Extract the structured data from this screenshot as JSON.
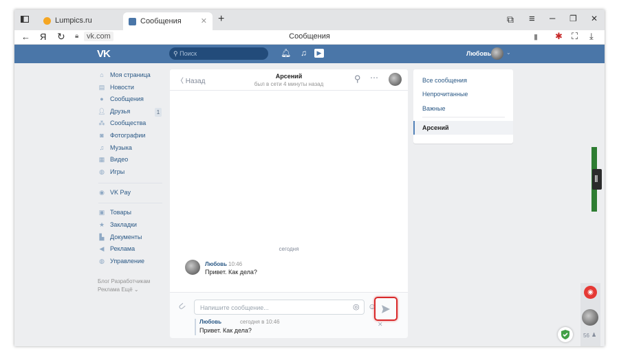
{
  "browser": {
    "tabs": [
      {
        "title": "Lumpics.ru",
        "favicon_color": "#f5a623"
      },
      {
        "title": "Сообщения",
        "favicon_color": "#4a76a8"
      }
    ],
    "new_tab": "+",
    "yandex_logo": "Я",
    "url": "vk.com",
    "page_title": "Сообщения"
  },
  "vk": {
    "header": {
      "logo": "VK",
      "search_placeholder": "Поиск",
      "user_name": "Любовь"
    },
    "left_menu": [
      {
        "label": "Моя страница",
        "icon": "home-icon"
      },
      {
        "label": "Новости",
        "icon": "news-icon"
      },
      {
        "label": "Сообщения",
        "icon": "messages-icon"
      },
      {
        "label": "Друзья",
        "icon": "friends-icon",
        "badge": "1"
      },
      {
        "label": "Сообщества",
        "icon": "groups-icon"
      },
      {
        "label": "Фотографии",
        "icon": "camera-icon"
      },
      {
        "label": "Музыка",
        "icon": "music-icon"
      },
      {
        "label": "Видео",
        "icon": "video-icon"
      },
      {
        "label": "Игры",
        "icon": "games-icon"
      },
      {
        "label": "VK Pay",
        "icon": "vkpay-icon"
      },
      {
        "label": "Товары",
        "icon": "goods-icon"
      },
      {
        "label": "Закладки",
        "icon": "bookmarks-icon"
      },
      {
        "label": "Документы",
        "icon": "documents-icon"
      },
      {
        "label": "Реклама",
        "icon": "ads-icon"
      },
      {
        "label": "Управление",
        "icon": "manage-icon"
      }
    ],
    "footer_links": {
      "line1": "Блог  Разработчикам",
      "line2": "Реклама  Ещё ⌄"
    },
    "chat": {
      "back_label": "Назад",
      "contact_name": "Арсений",
      "contact_status": "был в сети 4 минуты назад",
      "date_divider": "сегодня",
      "message": {
        "author": "Любовь",
        "time": "10:46",
        "text": "Привет. Как дела?"
      },
      "input_placeholder": "Напишите сообщение...",
      "reply_preview": {
        "author": "Любовь",
        "time": "сегодня в 10:46",
        "text": "Привет. Как дела?"
      }
    },
    "right_panel": {
      "items": [
        "Все сообщения",
        "Непрочитанные",
        "Важные"
      ],
      "selected_chat": "Арсений"
    },
    "online_count": "56",
    "colors": {
      "header": "#4a76a8",
      "link": "#2a5885",
      "highlight": "#d9292a",
      "background": "#edeef0"
    }
  }
}
